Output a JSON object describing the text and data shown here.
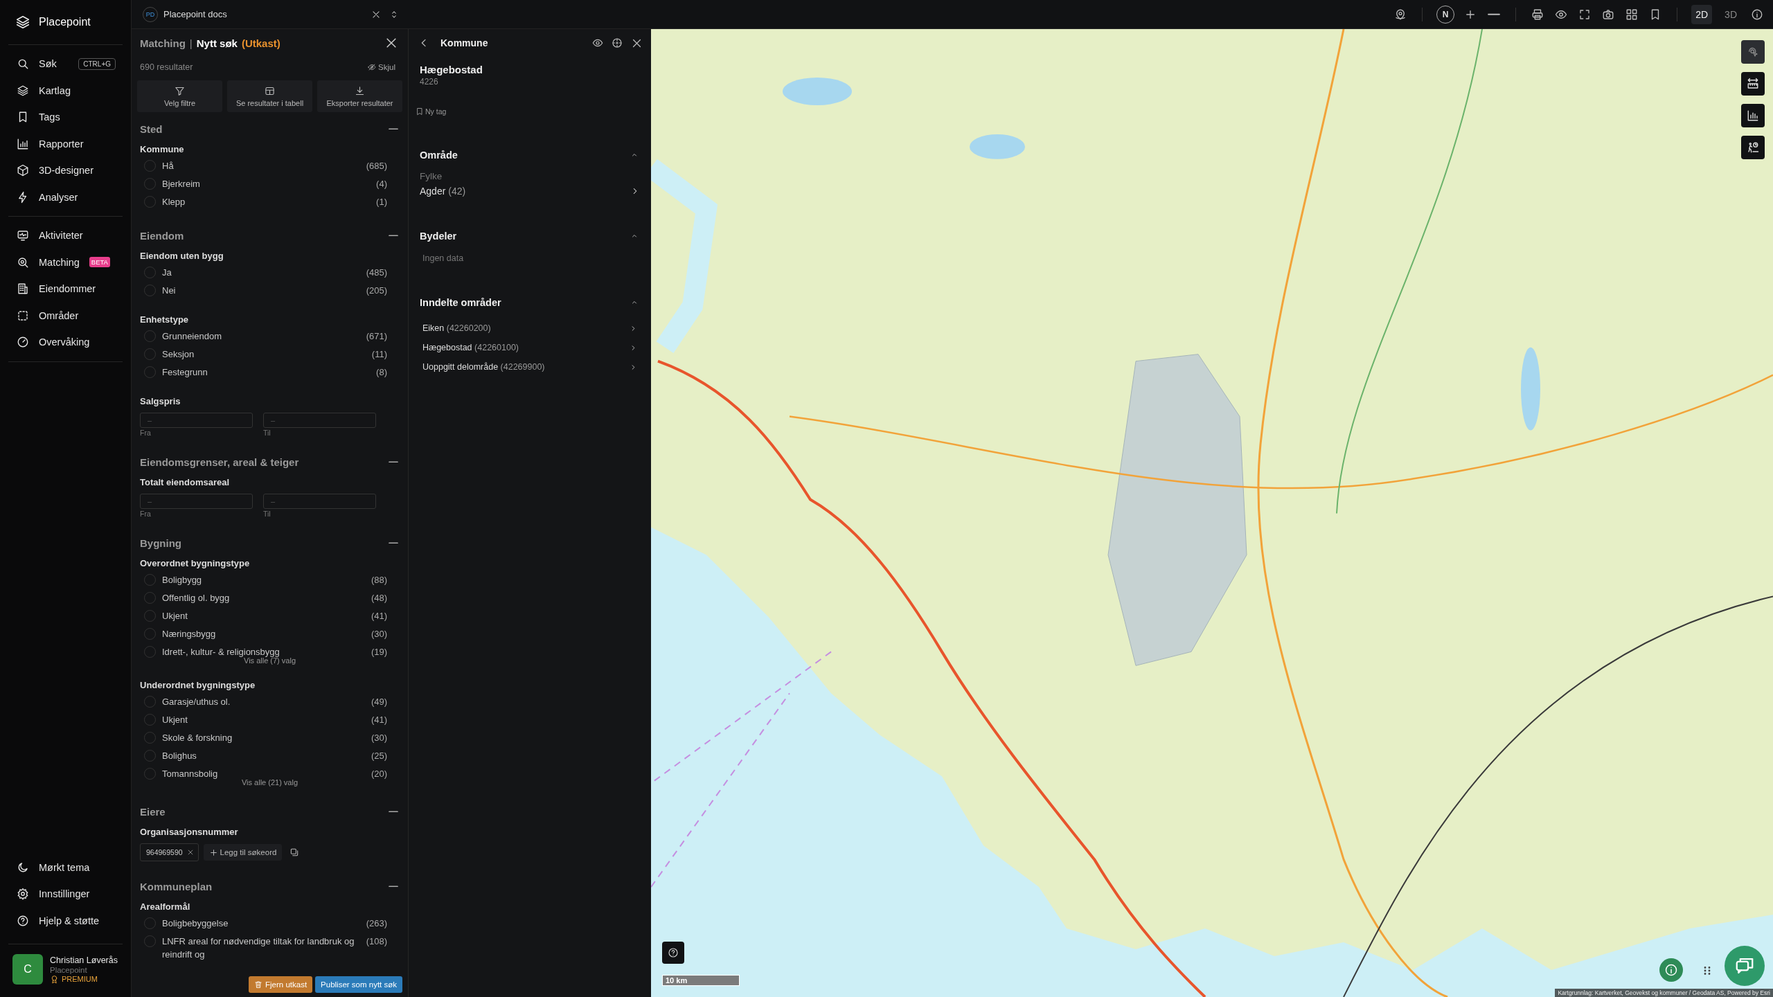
{
  "sidebar": {
    "brand": "Placepoint",
    "items": [
      {
        "label": "Søk",
        "shortcut": "CTRL+G"
      },
      {
        "label": "Kartlag"
      },
      {
        "label": "Tags"
      },
      {
        "label": "Rapporter"
      },
      {
        "label": "3D-designer"
      },
      {
        "label": "Analyser"
      }
    ],
    "items_2": [
      {
        "label": "Aktiviteter"
      },
      {
        "label": "Matching",
        "badge": "BETA"
      },
      {
        "label": "Eiendommer"
      },
      {
        "label": "Områder"
      },
      {
        "label": "Overvåking"
      }
    ],
    "bottom_items": [
      {
        "label": "Mørkt tema"
      },
      {
        "label": "Innstillinger"
      },
      {
        "label": "Hjelp & støtte"
      }
    ],
    "user": {
      "initial": "C",
      "name": "Christian Løverås",
      "org": "Placepoint",
      "plan": "PREMIUM"
    }
  },
  "topbar": {
    "workspace": {
      "initials": "PD",
      "name": "Placepoint docs"
    },
    "compass": "N",
    "view_modes": [
      {
        "label": "2D",
        "selected": true
      },
      {
        "label": "3D",
        "selected": false
      }
    ]
  },
  "filters": {
    "breadcrumb": "Matching",
    "separator": "|",
    "title": "Nytt søk",
    "status": "(Utkast)",
    "result_count": "690 resultater",
    "hide": "Skjul",
    "actions": [
      "Velg filtre",
      "Se resultater i tabell",
      "Eksporter resultater"
    ],
    "sections": [
      {
        "title": "Sted",
        "expanded": true,
        "groups": [
          {
            "kind": "options",
            "label": "Kommune",
            "options": [
              {
                "label": "Hå",
                "count": "(685)",
                "checked": false
              },
              {
                "label": "Bjerkreim",
                "count": "(4)",
                "checked": false
              },
              {
                "label": "Klepp",
                "count": "(1)",
                "checked": false
              }
            ]
          }
        ]
      },
      {
        "title": "Eiendom",
        "expanded": true,
        "groups": [
          {
            "kind": "options",
            "label": "Eiendom uten bygg",
            "options": [
              {
                "label": "Ja",
                "count": "(485)",
                "checked": false
              },
              {
                "label": "Nei",
                "count": "(205)",
                "checked": false
              }
            ]
          },
          {
            "kind": "options",
            "label": "Enhetstype",
            "options": [
              {
                "label": "Grunneiendom",
                "count": "(671)",
                "checked": false
              },
              {
                "label": "Seksjon",
                "count": "(11)",
                "checked": false
              },
              {
                "label": "Festegrunn",
                "count": "(8)",
                "checked": false
              }
            ]
          },
          {
            "kind": "range",
            "label": "Salgspris",
            "from": {
              "placeholder": "–",
              "caption": "Fra"
            },
            "to": {
              "placeholder": "–",
              "caption": "Til"
            }
          }
        ]
      },
      {
        "title": "Eiendomsgrenser, areal & teiger",
        "expanded": true,
        "groups": [
          {
            "kind": "range",
            "label": "Totalt eiendomsareal",
            "from": {
              "placeholder": "–",
              "caption": "Fra"
            },
            "to": {
              "placeholder": "–",
              "caption": "Til"
            }
          }
        ]
      },
      {
        "title": "Bygning",
        "expanded": true,
        "groups": [
          {
            "kind": "options",
            "label": "Overordnet bygningstype",
            "more": "Vis alle (7) valg",
            "options": [
              {
                "label": "Boligbygg",
                "count": "(88)",
                "checked": false
              },
              {
                "label": "Offentlig ol. bygg",
                "count": "(48)",
                "checked": false
              },
              {
                "label": "Ukjent",
                "count": "(41)",
                "checked": false
              },
              {
                "label": "Næringsbygg",
                "count": "(30)",
                "checked": false
              },
              {
                "label": "Idrett-, kultur- & religionsbygg",
                "count": "(19)",
                "checked": false
              }
            ]
          },
          {
            "kind": "options",
            "label": "Underordnet bygningstype",
            "more": "Vis alle (21) valg",
            "options": [
              {
                "label": "Garasje/uthus ol.",
                "count": "(49)",
                "checked": false
              },
              {
                "label": "Ukjent",
                "count": "(41)",
                "checked": false
              },
              {
                "label": "Skole & forskning",
                "count": "(30)",
                "checked": false
              },
              {
                "label": "Bolighus",
                "count": "(25)",
                "checked": false
              },
              {
                "label": "Tomannsbolig",
                "count": "(20)",
                "checked": false
              }
            ]
          }
        ]
      },
      {
        "title": "Eiere",
        "expanded": true,
        "groups": [
          {
            "kind": "tags",
            "label": "Organisasjonsnummer",
            "tags": [
              "964969590"
            ],
            "add": "Legg til søkeord"
          }
        ]
      },
      {
        "title": "Kommuneplan",
        "expanded": true,
        "groups": [
          {
            "kind": "options",
            "label": "Arealformål",
            "options": [
              {
                "label": "Boligbebyggelse",
                "count": "(263)",
                "checked": false
              },
              {
                "label": "LNFR areal for nødvendige tiltak for landbruk og reindrift og",
                "count": "(108)",
                "checked": false
              }
            ]
          }
        ]
      }
    ],
    "discard": "Fjern utkast",
    "publish": "Publiser som nytt søk"
  },
  "detail": {
    "header": "Kommune",
    "name": "Hægebostad",
    "code": "4226",
    "tag_button": "Ny tag",
    "sections": [
      {
        "kind": "link",
        "title": "Område",
        "expanded": true,
        "label": "Fylke",
        "name": "Agder",
        "code": "(42)"
      },
      {
        "kind": "empty",
        "title": "Bydeler",
        "expanded": true,
        "text": "Ingen data"
      },
      {
        "kind": "list",
        "title": "Inndelte områder",
        "expanded": true,
        "items": [
          {
            "name": "Eiken",
            "code": "(42260200)"
          },
          {
            "name": "Hægebostad",
            "code": "(42260100)"
          },
          {
            "name": "Uoppgitt delområde",
            "code": "(42269900)"
          }
        ]
      }
    ]
  },
  "map": {
    "tools": [
      {
        "disabled": true
      },
      {
        "disabled": false
      },
      {
        "disabled": false
      },
      {
        "disabled": false
      }
    ],
    "scale": "10 km",
    "attribution": "Kartgrunnlag: Kartverket, Geovekst og kommuner / Geodata AS, Powered by Esri"
  }
}
